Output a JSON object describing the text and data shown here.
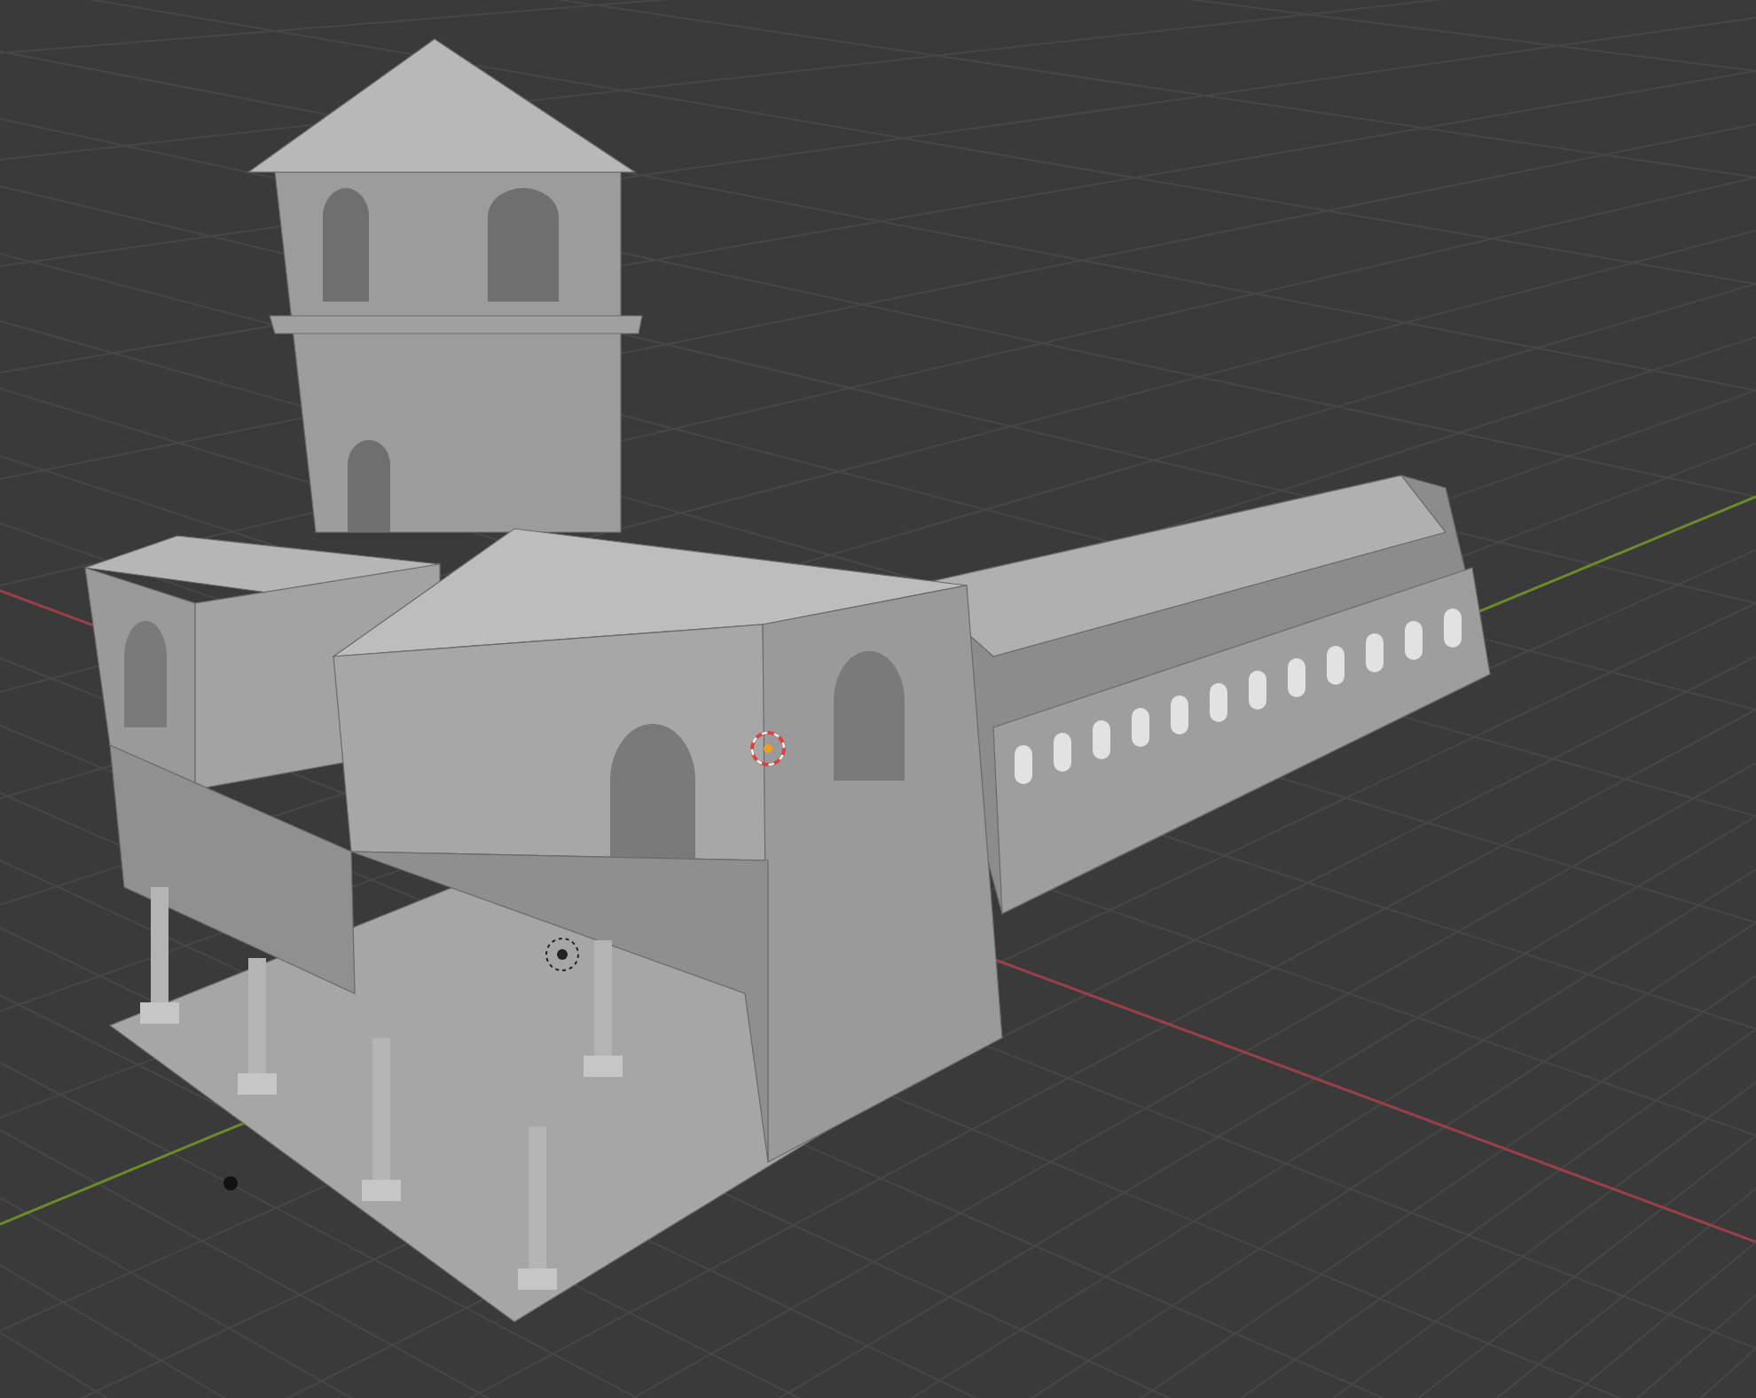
{
  "viewport": {
    "show_grid": true,
    "show_axes": true,
    "show_cursor": true
  }
}
